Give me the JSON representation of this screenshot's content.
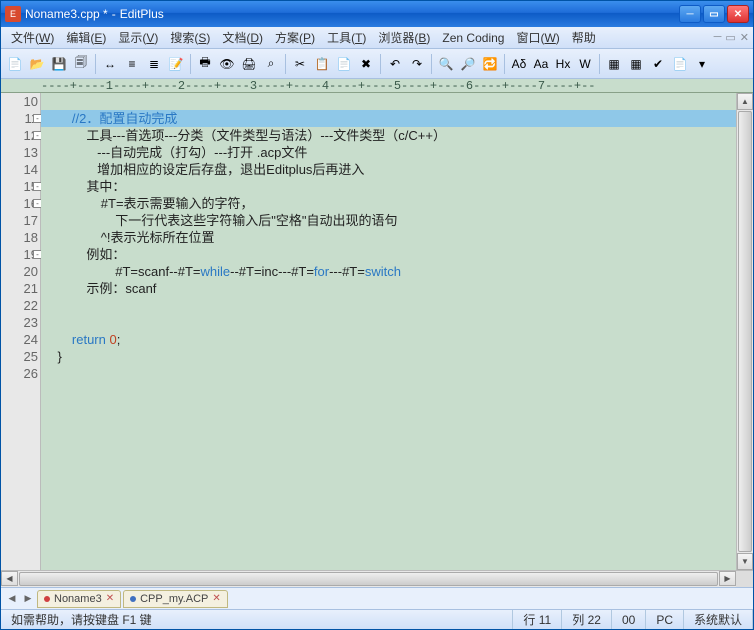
{
  "title": {
    "filename": "Noname3.cpp *",
    "sep": "-",
    "app": "EditPlus"
  },
  "menu": [
    {
      "label": "文件",
      "key": "W"
    },
    {
      "label": "编辑",
      "key": "E"
    },
    {
      "label": "显示",
      "key": "V"
    },
    {
      "label": "搜索",
      "key": "S"
    },
    {
      "label": "文档",
      "key": "D"
    },
    {
      "label": "方案",
      "key": "P"
    },
    {
      "label": "工具",
      "key": "T"
    },
    {
      "label": "浏览器",
      "key": "B"
    },
    {
      "label": "Zen Coding",
      "key": ""
    },
    {
      "label": "窗口",
      "key": "W"
    },
    {
      "label": "帮助",
      "key": ""
    }
  ],
  "toolbar_icons": [
    "📄",
    "📂",
    "💾",
    "🗐",
    "|",
    "↔",
    "≡",
    "≣",
    "📝",
    "|",
    "🖶",
    "👁",
    "🖨",
    "⌕",
    "|",
    "✂",
    "📋",
    "📄",
    "✖",
    "|",
    "↶",
    "↷",
    "|",
    "🔍",
    "🔎",
    "🔁",
    "|",
    "Aδ",
    "Aa",
    "Hx",
    "W",
    "|",
    "▦",
    "▦",
    "✔",
    "📄",
    "▾"
  ],
  "ruler": "----+----1----+----2----+----3----+----4----+----5----+----6----+----7----+--",
  "lines": [
    {
      "n": 10,
      "fold": false,
      "text": ""
    },
    {
      "n": 11,
      "fold": true,
      "sel": true,
      "segs": [
        {
          "t": "        ",
          "c": ""
        },
        {
          "t": "//2．配置自动完成",
          "c": "cmt"
        }
      ]
    },
    {
      "n": 12,
      "fold": true,
      "segs": [
        {
          "t": "            工具---首选项---分类（文件类型与语法）---文件类型（c/C++）",
          "c": ""
        }
      ]
    },
    {
      "n": 13,
      "fold": false,
      "segs": [
        {
          "t": "               ---自动完成（打勾）---打开 .acp文件",
          "c": ""
        }
      ]
    },
    {
      "n": 14,
      "fold": false,
      "segs": [
        {
          "t": "               增加相应的设定后存盘，退出Editplus后再进入",
          "c": ""
        }
      ]
    },
    {
      "n": 15,
      "fold": true,
      "segs": [
        {
          "t": "            其中：",
          "c": ""
        }
      ]
    },
    {
      "n": 16,
      "fold": true,
      "segs": [
        {
          "t": "                #T=表示需要输入的字符，",
          "c": ""
        }
      ]
    },
    {
      "n": 17,
      "fold": false,
      "segs": [
        {
          "t": "                    下一行代表这些字符输入后\"空格\"自动出现的语句",
          "c": ""
        }
      ]
    },
    {
      "n": 18,
      "fold": false,
      "segs": [
        {
          "t": "                ^!表示光标所在位置",
          "c": ""
        }
      ]
    },
    {
      "n": 19,
      "fold": true,
      "segs": [
        {
          "t": "            例如：",
          "c": ""
        }
      ]
    },
    {
      "n": 20,
      "fold": false,
      "segs": [
        {
          "t": "                    #T=scanf--#T=",
          "c": ""
        },
        {
          "t": "while",
          "c": "kw"
        },
        {
          "t": "--#T=inc---#T=",
          "c": ""
        },
        {
          "t": "for",
          "c": "kw"
        },
        {
          "t": "---#T=",
          "c": ""
        },
        {
          "t": "switch",
          "c": "kw"
        }
      ]
    },
    {
      "n": 21,
      "fold": false,
      "segs": [
        {
          "t": "            示例：scanf",
          "c": ""
        }
      ]
    },
    {
      "n": 22,
      "fold": false,
      "text": ""
    },
    {
      "n": 23,
      "fold": false,
      "text": ""
    },
    {
      "n": 24,
      "fold": false,
      "segs": [
        {
          "t": "        ",
          "c": ""
        },
        {
          "t": "return",
          "c": "kw"
        },
        {
          "t": " ",
          "c": ""
        },
        {
          "t": "0",
          "c": "num"
        },
        {
          "t": ";",
          "c": ""
        }
      ]
    },
    {
      "n": 25,
      "fold": false,
      "segs": [
        {
          "t": "    }",
          "c": ""
        }
      ]
    },
    {
      "n": 26,
      "fold": false,
      "text": ""
    }
  ],
  "tabs": [
    {
      "name": "Noname3",
      "color": "red",
      "active": false
    },
    {
      "name": "CPP_my.ACP",
      "color": "blue",
      "active": false
    }
  ],
  "status": {
    "hint": "如需帮助，请按键盘 F1 键",
    "line_lbl": "行",
    "line": "11",
    "col_lbl": "列",
    "col": "22",
    "total": "00",
    "enc": "PC",
    "ime": "系统默认"
  }
}
